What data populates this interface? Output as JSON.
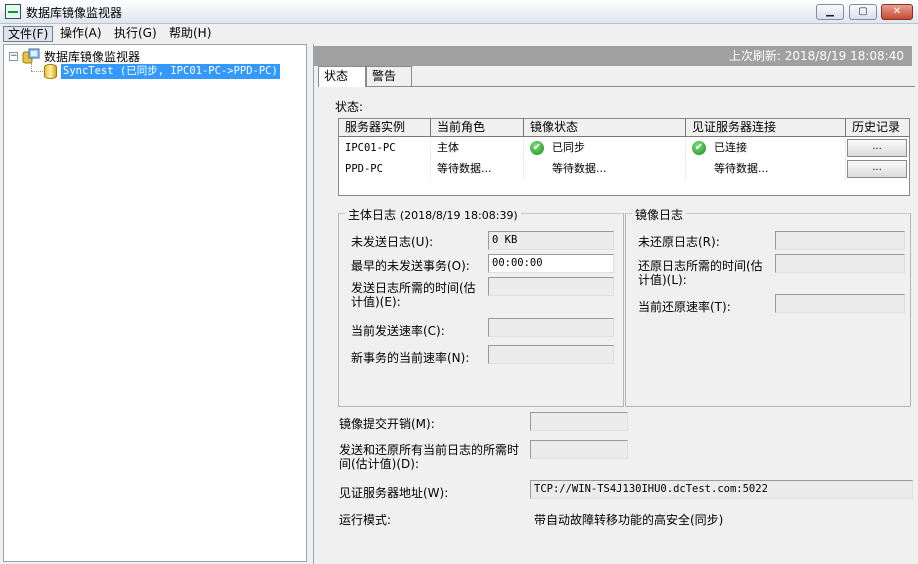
{
  "window": {
    "title": "数据库镜像监视器",
    "controls": {
      "minimize": "▁",
      "maximize": "▢",
      "close": "✕"
    }
  },
  "menu": {
    "items": [
      {
        "label": "文件(F)"
      },
      {
        "label": "操作(A)"
      },
      {
        "label": "执行(G)"
      },
      {
        "label": "帮助(H)"
      }
    ]
  },
  "tree": {
    "expander": "−",
    "root_label": "数据库镜像监视器",
    "child_label": "SyncTest (已同步, IPC01-PC->PPD-PC)"
  },
  "status_bar": {
    "last_refresh": "上次刷新: 2018/8/19 18:08:40"
  },
  "tabs": [
    {
      "label": "状态"
    },
    {
      "label": "警告"
    }
  ],
  "status_section": {
    "title": "状态:",
    "columns": [
      "服务器实例",
      "当前角色",
      "镜像状态",
      "见证服务器连接",
      "历史记录"
    ],
    "rows": [
      {
        "instance": "IPC01-PC",
        "role": "主体",
        "mirror_state": "已同步",
        "witness": "已连接",
        "history": "..."
      },
      {
        "instance": "PPD-PC",
        "role": "等待数据...",
        "mirror_state": "等待数据...",
        "witness": "等待数据...",
        "history": "..."
      }
    ]
  },
  "principal_log": {
    "title": "主体日志",
    "timestamp": "(2018/8/19 18:08:39)",
    "unsent_log_label": "未发送日志(U):",
    "unsent_log_value": "0 KB",
    "oldest_unsent_label": "最早的未发送事务(O):",
    "oldest_unsent_value": "00:00:00",
    "send_time_label": "发送日志所需的时间(估计值)(E):",
    "send_time_value": "",
    "send_rate_label": "当前发送速率(C):",
    "send_rate_value": "",
    "new_txn_rate_label": "新事务的当前速率(N):",
    "new_txn_rate_value": ""
  },
  "mirror_log": {
    "title": "镜像日志",
    "unrestored_label": "未还原日志(R):",
    "unrestored_value": "",
    "restore_time_label": "还原日志所需的时间(估计值)(L):",
    "restore_time_value": "",
    "restore_rate_label": "当前还原速率(T):",
    "restore_rate_value": ""
  },
  "bottom": {
    "commit_overhead_label": "镜像提交开销(M):",
    "commit_overhead_value": "",
    "total_time_label": "发送和还原所有当前日志的所需时间(估计值)(D):",
    "total_time_value": "",
    "witness_address_label": "见证服务器地址(W):",
    "witness_address_value": "TCP://WIN-TS4J130IHU0.dcTest.com:5022",
    "operating_mode_label": "运行模式:",
    "operating_mode_value": "带自动故障转移功能的高安全(同步)"
  }
}
